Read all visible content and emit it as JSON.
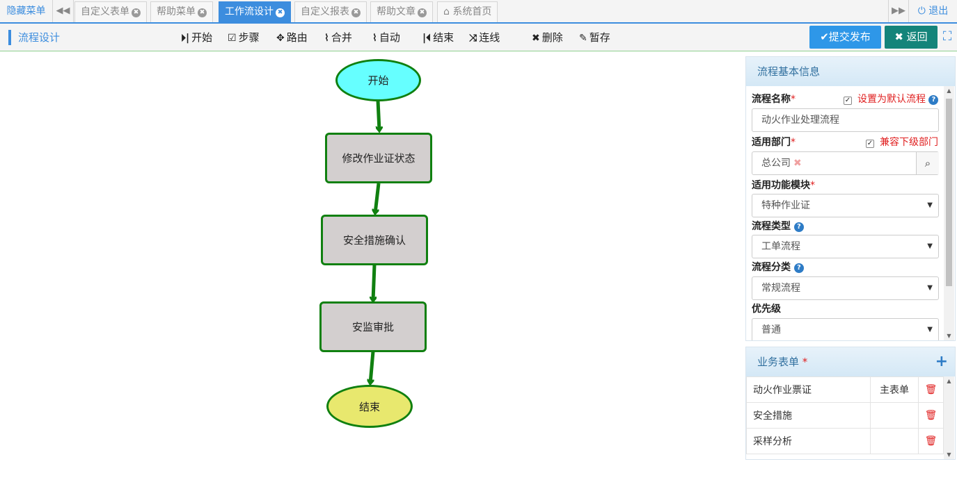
{
  "tabbar": {
    "hide_menu": "隐藏菜单",
    "tabs": [
      {
        "label": "自定义表单",
        "active": false
      },
      {
        "label": "帮助菜单",
        "active": false
      },
      {
        "label": "工作流设计",
        "active": true
      },
      {
        "label": "自定义报表",
        "active": false
      },
      {
        "label": "帮助文章",
        "active": false
      },
      {
        "label": "系统首页",
        "active": false
      }
    ],
    "logout": "退出"
  },
  "toolbar": {
    "title": "流程设计",
    "tools": {
      "start": "开始",
      "step": "步骤",
      "route": "路由",
      "merge": "合并",
      "auto": "自动",
      "end": "结束",
      "connect": "连线",
      "delete": "删除",
      "save": "暂存"
    },
    "publish": "提交发布",
    "back": "返回"
  },
  "flow": {
    "nodes": {
      "start": "开始",
      "step1": "修改作业证状态",
      "step2": "安全措施确认",
      "step3": "安监审批",
      "end": "结束"
    },
    "colors": {
      "start": "#66ffff",
      "step": "#d3cfcf",
      "end": "#e8e86e",
      "line": "#108010"
    }
  },
  "basic_info": {
    "title": "流程基本信息",
    "flow_name_label": "流程名称",
    "default_flow_label": "设置为默认流程",
    "flow_name_value": "动火作业处理流程",
    "dept_label": "适用部门",
    "include_sub_label": "兼容下级部门",
    "dept_value": "总公司",
    "module_label": "适用功能模块",
    "module_value": "特种作业证",
    "type_label": "流程类型",
    "type_value": "工单流程",
    "category_label": "流程分类",
    "category_value": "常规流程",
    "priority_label": "优先级",
    "priority_value": "普通"
  },
  "forms": {
    "title": "业务表单",
    "rows": [
      {
        "name": "动火作业票证",
        "type": "主表单"
      },
      {
        "name": "安全措施",
        "type": ""
      },
      {
        "name": "采样分析",
        "type": ""
      }
    ]
  }
}
